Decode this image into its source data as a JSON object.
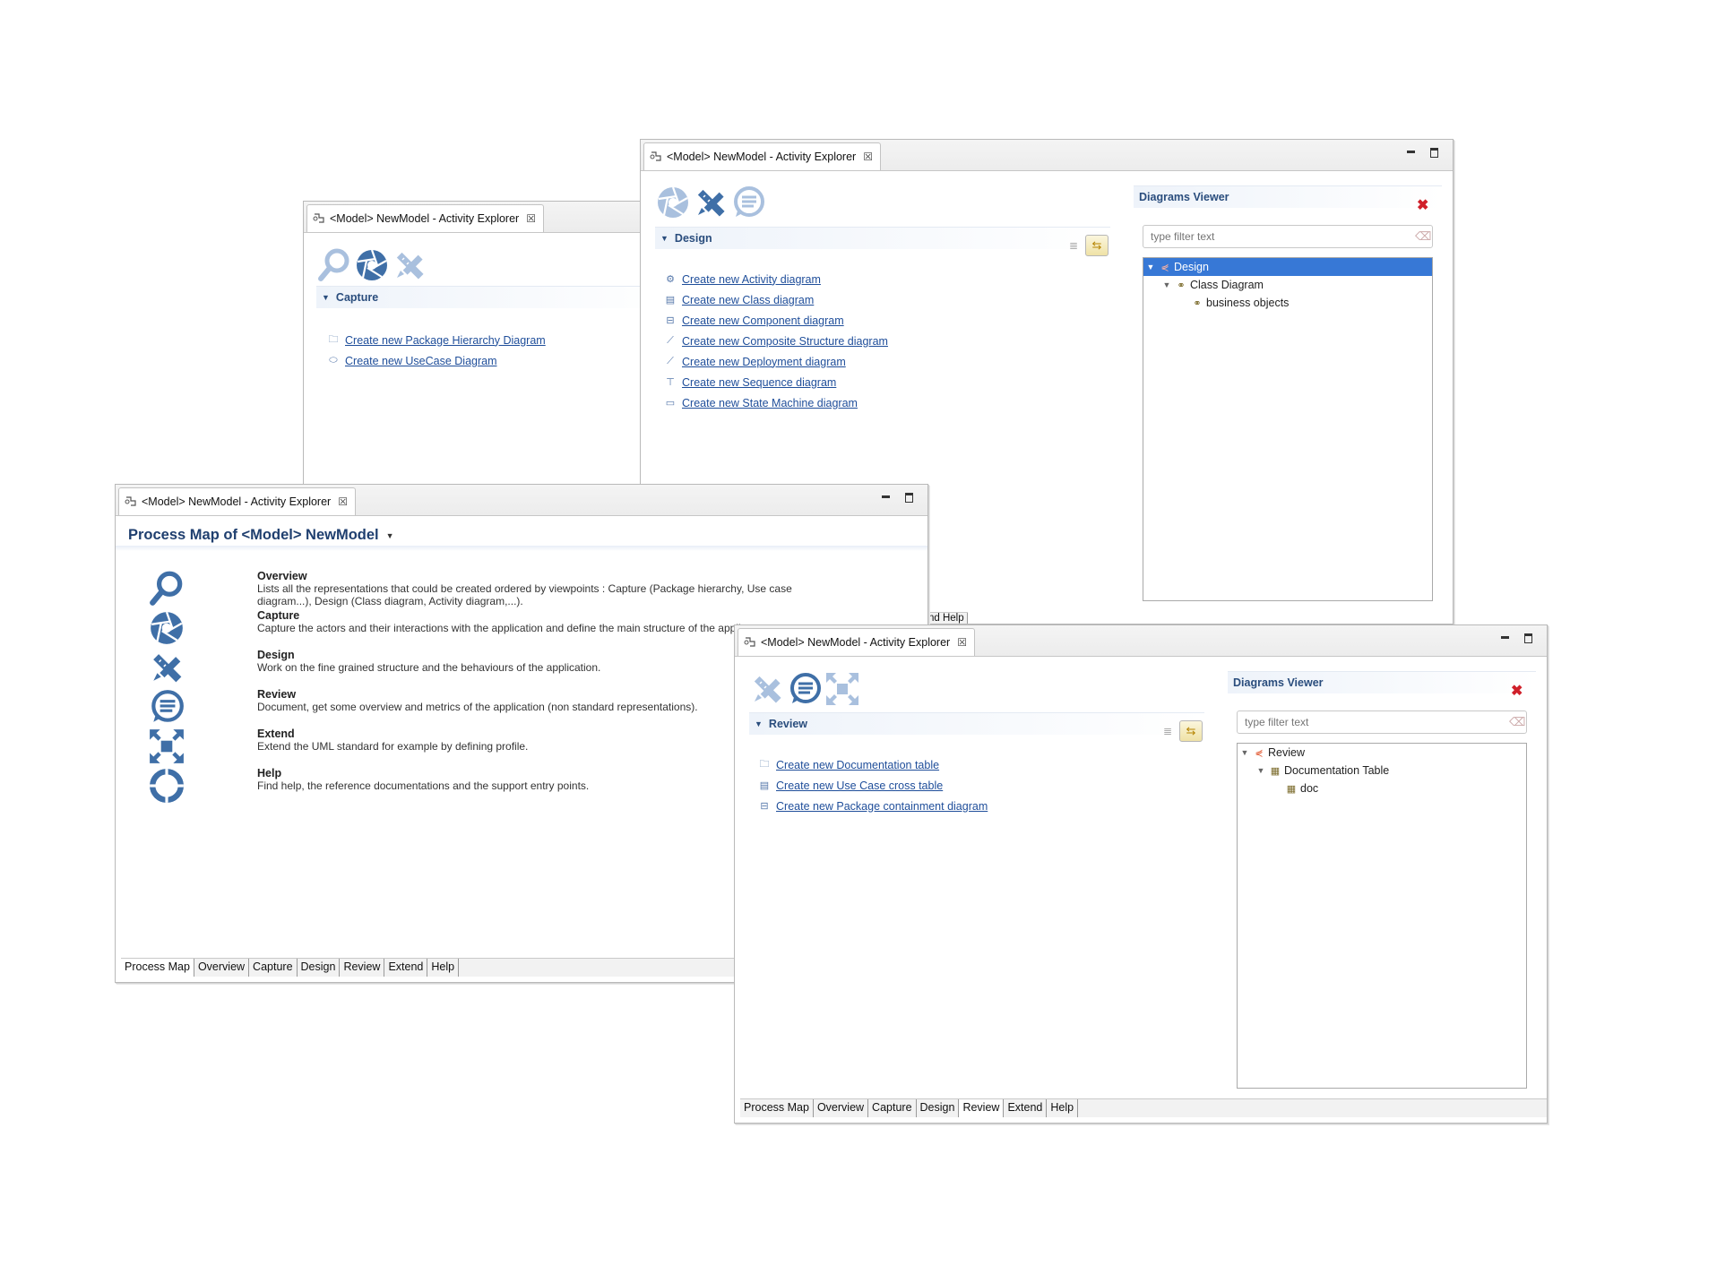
{
  "colors": {
    "accent": "#4a78b0",
    "link": "#1f4e9a",
    "heading": "#2a4d7d",
    "selection": "#3778d6"
  },
  "window_capture": {
    "tab_title": "<Model> NewModel - Activity Explorer",
    "section": "Capture",
    "links": [
      {
        "label": "Create new Package Hierarchy Diagram",
        "icon": "package-icon"
      },
      {
        "label": "Create new UseCase Diagram",
        "icon": "usecase-icon"
      }
    ]
  },
  "window_design": {
    "tab_title": "<Model> NewModel - Activity Explorer",
    "section": "Design",
    "links": [
      {
        "label": "Create new Activity diagram",
        "icon": "activity-icon"
      },
      {
        "label": "Create new Class diagram",
        "icon": "class-icon"
      },
      {
        "label": "Create new Component diagram",
        "icon": "component-icon"
      },
      {
        "label": "Create new Composite Structure diagram",
        "icon": "composite-icon"
      },
      {
        "label": "Create new Deployment diagram",
        "icon": "deployment-icon"
      },
      {
        "label": "Create new Sequence diagram",
        "icon": "sequence-icon"
      },
      {
        "label": "Create new State Machine diagram",
        "icon": "state-machine-icon"
      }
    ],
    "viewer": {
      "title": "Diagrams Viewer",
      "filter_placeholder": "type filter text",
      "tree": [
        {
          "label": "Design",
          "level": 0,
          "expanded": true,
          "selected": true
        },
        {
          "label": "Class Diagram",
          "level": 1,
          "expanded": true,
          "selected": false
        },
        {
          "label": "business objects",
          "level": 2,
          "expanded": false,
          "selected": false
        }
      ]
    }
  },
  "window_process": {
    "tab_title": "<Model> NewModel - Activity Explorer",
    "title": "Process Map of <Model> NewModel",
    "items": [
      {
        "name": "Overview",
        "desc": "Lists all the representations that could be created ordered by viewpoints : Capture (Package hierarchy, Use case diagram...), Design (Class diagram, Activity diagram,...).",
        "icon": "magnifier-icon"
      },
      {
        "name": "Capture",
        "desc": "Capture the actors and their interactions with the application and define the main structure of the applic",
        "icon": "aperture-icon"
      },
      {
        "name": "Design",
        "desc": "Work on the fine grained structure and the behaviours of the application.",
        "icon": "pencil-ruler-icon"
      },
      {
        "name": "Review",
        "desc": "Document, get some overview and metrics of the application (non standard representations).",
        "icon": "speech-bubble-icon"
      },
      {
        "name": "Extend",
        "desc": "Extend the UML standard for example by defining profile.",
        "icon": "expand-arrows-icon"
      },
      {
        "name": "Help",
        "desc": "Find help, the reference documentations and the support entry points.",
        "icon": "lifebuoy-icon"
      }
    ],
    "bottom_tabs": [
      "Process Map",
      "Overview",
      "Capture",
      "Design",
      "Review",
      "Extend",
      "Help"
    ],
    "active_tab": "Process Map"
  },
  "window_review": {
    "tab_title": "<Model> NewModel - Activity Explorer",
    "section": "Review",
    "links": [
      {
        "label": "Create new Documentation table",
        "icon": "package-icon"
      },
      {
        "label": "Create new Use Case cross table",
        "icon": "table-icon"
      },
      {
        "label": "Create new Package containment diagram",
        "icon": "component-icon"
      }
    ],
    "viewer": {
      "title": "Diagrams Viewer",
      "filter_placeholder": "type filter text",
      "tree": [
        {
          "label": "Review",
          "level": 0,
          "expanded": true,
          "selected": false
        },
        {
          "label": "Documentation Table",
          "level": 1,
          "expanded": true,
          "selected": false
        },
        {
          "label": "doc",
          "level": 2,
          "expanded": false,
          "selected": false
        }
      ]
    },
    "bottom_tabs": [
      "Process Map",
      "Overview",
      "Capture",
      "Design",
      "Review",
      "Extend",
      "Help"
    ],
    "active_tab": "Review"
  },
  "behind_tabs_fragment": "nd Help"
}
